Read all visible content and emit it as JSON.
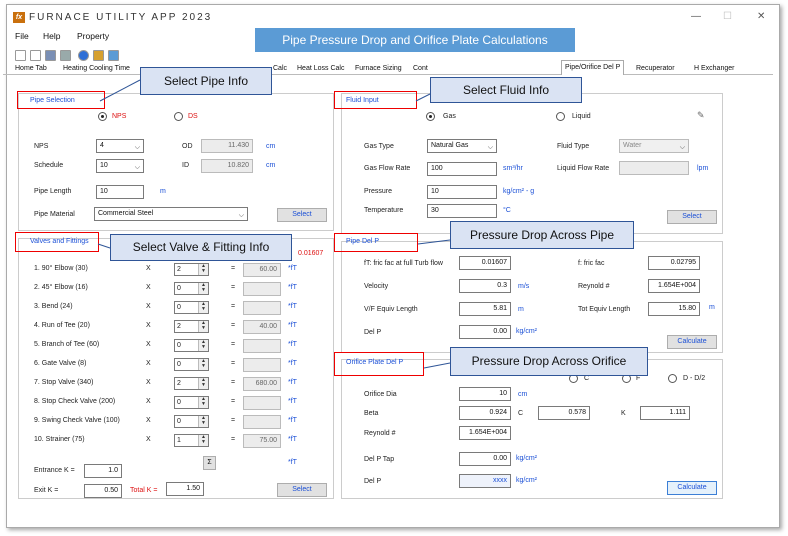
{
  "app": {
    "title": "FURNACE UTILITY APP 2023",
    "icon": "fx"
  },
  "window": {
    "minimize": "—",
    "maximize": "☐",
    "close": "✕"
  },
  "menu": [
    "File",
    "Help",
    "Property"
  ],
  "banner": "Pipe Pressure Drop and Orifice Plate Calculations",
  "tabs": [
    "Home Tab",
    "Heating Cooling Time",
    "Calc",
    "Heat Loss Calc",
    "Furnace Sizing",
    "Cont",
    "Pipe/Orifice Del P",
    "Recuperator",
    "H Exchanger"
  ],
  "callouts": {
    "pipe_info": "Select Pipe Info",
    "fluid_info": "Select Fluid Info",
    "valve": "Select Valve & Fitting Info",
    "pipe_dp": "Pressure Drop Across Pipe",
    "orifice_dp": "Pressure Drop Across Orifice"
  },
  "pipe": {
    "title": "Pipe Selection",
    "nps_radio": "NPS",
    "ds_radio": "DS",
    "nps_label": "NPS",
    "nps": "4",
    "schedule_label": "Schedule",
    "schedule": "10",
    "od_label": "OD",
    "od": "11.430",
    "id_label": "ID",
    "id": "10.820",
    "od_unit": "cm",
    "id_unit": "cm",
    "length_label": "Pipe Length",
    "length": "10",
    "length_unit": "m",
    "material_label": "Pipe Material",
    "material": "Commercial Steel",
    "select": "Select"
  },
  "valves": {
    "title": "Valves and Fittings",
    "ft_value": "0.01607",
    "x": "X",
    "eq": "=",
    "ft": "*fT",
    "items": [
      {
        "label": "1.   90° Elbow (30)",
        "qty": "2",
        "val": "60.00"
      },
      {
        "label": "2.   45° Elbow (16)",
        "qty": "0",
        "val": ""
      },
      {
        "label": "3.   Bend (24)",
        "qty": "0",
        "val": ""
      },
      {
        "label": "4.   Run of Tee (20)",
        "qty": "2",
        "val": "40.00"
      },
      {
        "label": "5.   Branch of Tee (60)",
        "qty": "0",
        "val": ""
      },
      {
        "label": "6.   Gate Valve (8)",
        "qty": "0",
        "val": ""
      },
      {
        "label": "7.   Stop Valve (340)",
        "qty": "2",
        "val": "680.00"
      },
      {
        "label": "8.   Stop Check Valve (200)",
        "qty": "0",
        "val": ""
      },
      {
        "label": "9.   Swing Check Valve (100)",
        "qty": "0",
        "val": ""
      },
      {
        "label": "10.  Strainer (75)",
        "qty": "1",
        "val": "75.00"
      }
    ],
    "sigma": "Σ",
    "entrance_label": "Entrance K =",
    "entrance": "1.0",
    "exit_label": "Exit K =",
    "exit": "0.50",
    "totalk_label": "Total K =",
    "totalk": "1.50",
    "select": "Select"
  },
  "fluid": {
    "title": "Fluid Input",
    "gas_radio": "Gas",
    "liquid_radio": "Liquid",
    "gas_type_label": "Gas Type",
    "gas_type": "Natural Gas",
    "flow_label": "Gas Flow Rate",
    "flow": "100",
    "flow_unit": "sm³/hr",
    "pressure_label": "Pressure",
    "pressure": "10",
    "pressure_unit": "kg/cm² - g",
    "temp_label": "Temperature",
    "temp": "30",
    "temp_unit": "°C",
    "fluid_type_label": "Fluid Type",
    "fluid_type": "Water",
    "liq_flow_label": "Liquid Flow Rate",
    "liq_unit": "lpm",
    "select": "Select"
  },
  "pipedp": {
    "title": "Pipe Del P",
    "ft_label": "fT: fric fac at full Turb flow",
    "ft": "0.01607",
    "f_label": "f: fric fac",
    "f": "0.02795",
    "vel_label": "Velocity",
    "vel": "0.3",
    "vel_unit": "m/s",
    "re_label": "Reynold #",
    "re": "1.654E+004",
    "vf_label": "V/F Equiv Length",
    "vf": "5.81",
    "vf_unit": "m",
    "tot_label": "Tot Equiv Length",
    "tot": "15.80",
    "tot_unit": "m",
    "delp_label": "Del P",
    "delp": "0.00",
    "delp_unit": "kg/cm²",
    "calc": "Calculate"
  },
  "orifice": {
    "title": "Orifice Plate Del P",
    "r1": "C",
    "r2": "F",
    "r3": "D - D/2",
    "dia_label": "Orifice Dia",
    "dia": "10",
    "dia_unit": "cm",
    "beta_label": "Beta",
    "beta": "0.924",
    "c_label": "C",
    "c": "0.578",
    "k_label": "K",
    "k": "1.111",
    "re_label": "Reynold #",
    "re": "1.654E+004",
    "tap_label": "Del P Tap",
    "tap": "0.00",
    "tap_unit": "kg/cm²",
    "delp_label": "Del P",
    "delp": "xxxx",
    "delp_unit": "kg/cm²",
    "calc": "Calculate"
  },
  "colors": {
    "banner": "#5b9bd5",
    "callout_bg": "#dae3f3",
    "callout_border": "#2f5597",
    "highlight": "#ee0000",
    "label_blue": "#1a4fd6"
  }
}
